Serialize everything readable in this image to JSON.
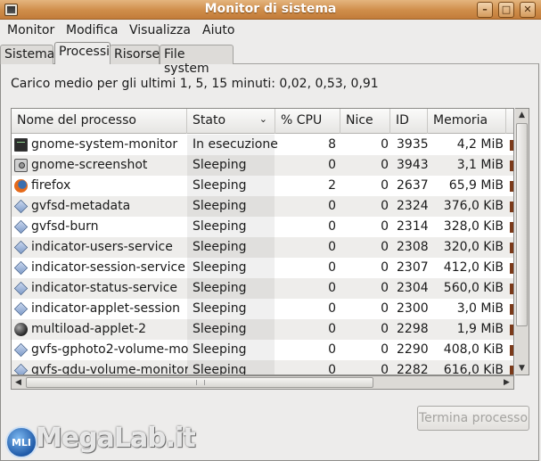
{
  "window": {
    "title": "Monitor di sistema"
  },
  "menu": [
    "Monitor",
    "Modifica",
    "Visualizza",
    "Aiuto"
  ],
  "tabs": [
    "Sistema",
    "Processi",
    "Risorse",
    "File system"
  ],
  "load_average": "Carico medio per gli ultimi 1, 5, 15 minuti: 0,02, 0,53, 0,91",
  "columns": [
    "Nome del processo",
    "Stato",
    "% CPU",
    "Nice",
    "ID",
    "Memoria"
  ],
  "processes": [
    {
      "icon": "terminal-icon",
      "name": "gnome-system-monitor",
      "stato": "In esecuzione",
      "cpu": "8",
      "nice": "0",
      "id": "3935",
      "mem": "4,2 MiB"
    },
    {
      "icon": "camera-icon",
      "name": "gnome-screenshot",
      "stato": "Sleeping",
      "cpu": "0",
      "nice": "0",
      "id": "3943",
      "mem": "3,1 MiB"
    },
    {
      "icon": "firefox-icon",
      "name": "firefox",
      "stato": "Sleeping",
      "cpu": "2",
      "nice": "0",
      "id": "2637",
      "mem": "65,9 MiB"
    },
    {
      "icon": "process-icon",
      "name": "gvfsd-metadata",
      "stato": "Sleeping",
      "cpu": "0",
      "nice": "0",
      "id": "2324",
      "mem": "376,0 KiB"
    },
    {
      "icon": "process-icon",
      "name": "gvfsd-burn",
      "stato": "Sleeping",
      "cpu": "0",
      "nice": "0",
      "id": "2314",
      "mem": "328,0 KiB"
    },
    {
      "icon": "process-icon",
      "name": "indicator-users-service",
      "stato": "Sleeping",
      "cpu": "0",
      "nice": "0",
      "id": "2308",
      "mem": "320,0 KiB"
    },
    {
      "icon": "process-icon",
      "name": "indicator-session-service",
      "stato": "Sleeping",
      "cpu": "0",
      "nice": "0",
      "id": "2307",
      "mem": "412,0 KiB"
    },
    {
      "icon": "process-icon",
      "name": "indicator-status-service",
      "stato": "Sleeping",
      "cpu": "0",
      "nice": "0",
      "id": "2304",
      "mem": "560,0 KiB"
    },
    {
      "icon": "process-icon",
      "name": "indicator-applet-session",
      "stato": "Sleeping",
      "cpu": "0",
      "nice": "0",
      "id": "2300",
      "mem": "3,0 MiB"
    },
    {
      "icon": "ball-icon",
      "name": "multiload-applet-2",
      "stato": "Sleeping",
      "cpu": "0",
      "nice": "0",
      "id": "2298",
      "mem": "1,9 MiB"
    },
    {
      "icon": "process-icon",
      "name": "gvfs-gphoto2-volume-mon",
      "stato": "Sleeping",
      "cpu": "0",
      "nice": "0",
      "id": "2290",
      "mem": "408,0 KiB"
    },
    {
      "icon": "process-icon",
      "name": "gvfs-gdu-volume-monitor",
      "stato": "Sleeping",
      "cpu": "0",
      "nice": "0",
      "id": "2282",
      "mem": "616,0 KiB"
    }
  ],
  "buttons": {
    "kill": "Termina processo"
  },
  "watermark": {
    "badge": "MLI",
    "text": "MegaLab.it"
  }
}
